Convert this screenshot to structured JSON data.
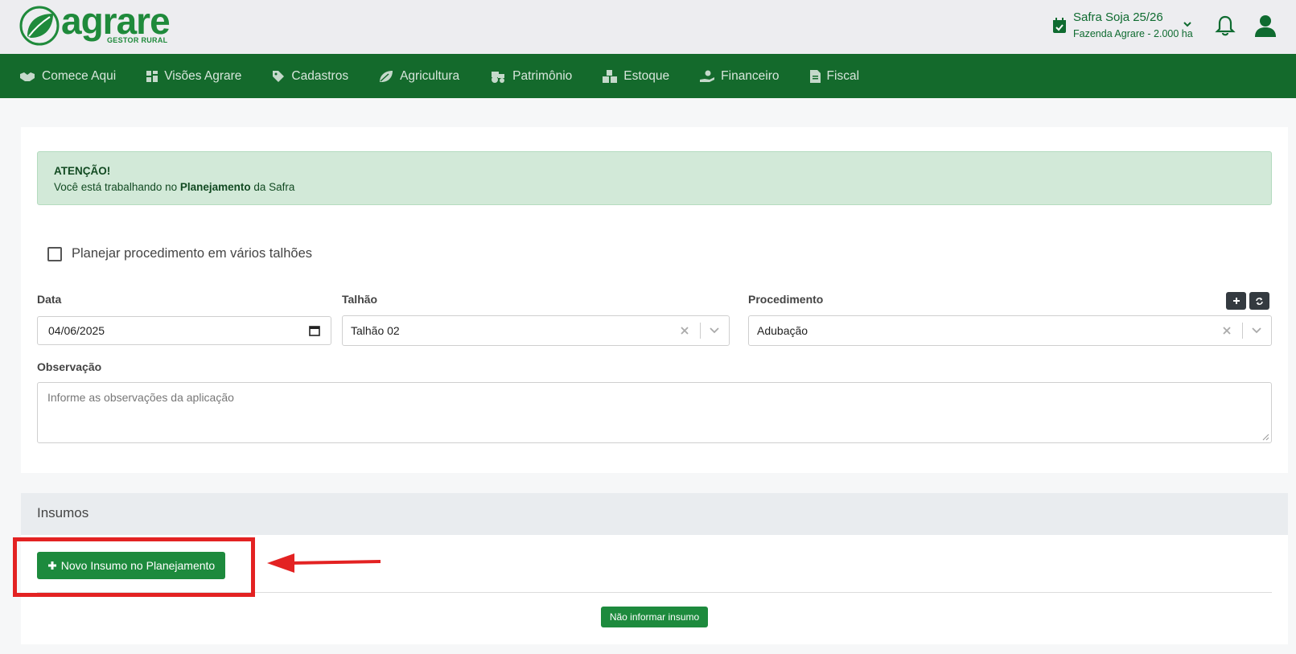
{
  "header": {
    "logo_word": "agrare",
    "logo_sub": "GESTOR RURAL",
    "safra_title": "Safra Soja 25/26",
    "safra_farm": "Fazenda Agrare - 2.000 ha"
  },
  "nav": {
    "items": [
      {
        "label": "Comece Aqui",
        "icon": "handshake-icon"
      },
      {
        "label": "Visões Agrare",
        "icon": "dashboard-grid-icon"
      },
      {
        "label": "Cadastros",
        "icon": "tags-icon"
      },
      {
        "label": "Agricultura",
        "icon": "leaf-icon"
      },
      {
        "label": "Patrimônio",
        "icon": "tractor-icon"
      },
      {
        "label": "Estoque",
        "icon": "boxes-icon"
      },
      {
        "label": "Financeiro",
        "icon": "hand-money-icon"
      },
      {
        "label": "Fiscal",
        "icon": "invoice-icon"
      }
    ]
  },
  "form": {
    "alert_title": "ATENÇÃO!",
    "alert_text_pre": "Você está trabalhando no ",
    "alert_text_bold": "Planejamento",
    "alert_text_post": " da Safra",
    "multi_plots_label": "Planejar procedimento em vários talhões",
    "date_label": "Data",
    "date_value": "04/06/2025",
    "plot_label": "Talhão",
    "plot_value": "Talhão 02",
    "procedure_label": "Procedimento",
    "procedure_value": "Adubação",
    "notes_label": "Observação",
    "notes_placeholder": "Informe as observações da aplicação"
  },
  "insumos": {
    "title": "Insumos",
    "new_button": "Novo Insumo no Planejamento",
    "skip_button": "Não informar insumo"
  },
  "colors": {
    "brand_green": "#1f8a3b",
    "nav_bg": "#146a2c",
    "button_green": "#1d8a3d",
    "annotation_red": "#e32222"
  }
}
